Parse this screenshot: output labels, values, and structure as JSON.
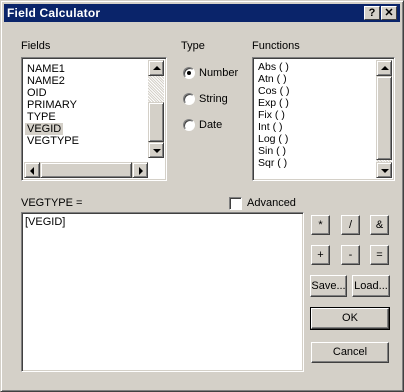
{
  "window": {
    "title": "Field Calculator",
    "help_glyph": "?",
    "close_glyph": "✕"
  },
  "fields": {
    "label": "Fields",
    "items": [
      "NAME1",
      "NAME2",
      "OID",
      "PRIMARY",
      "TYPE",
      "VEGID",
      "VEGTYPE"
    ],
    "selected": "VEGID"
  },
  "type": {
    "label": "Type",
    "options": [
      "Number",
      "String",
      "Date"
    ],
    "selected": "Number"
  },
  "functions": {
    "label": "Functions",
    "items": [
      "Abs ( )",
      "Atn ( )",
      "Cos ( )",
      "Exp ( )",
      "Fix ( )",
      "Int ( )",
      "Log ( )",
      "Sin ( )",
      "Sqr ( )"
    ]
  },
  "expression": {
    "label": "VEGTYPE =",
    "value": "[VEGID]"
  },
  "advanced": {
    "label": "Advanced",
    "checked": false
  },
  "operators": [
    "*",
    "/",
    "&",
    "+",
    "-",
    "="
  ],
  "buttons": {
    "save": "Save...",
    "load": "Load...",
    "ok": "OK",
    "cancel": "Cancel"
  },
  "icons": {
    "radio_selected": "radio-dot",
    "arrows": [
      "arrow-up-icon",
      "arrow-down-icon",
      "arrow-left-icon",
      "arrow-right-icon"
    ]
  }
}
